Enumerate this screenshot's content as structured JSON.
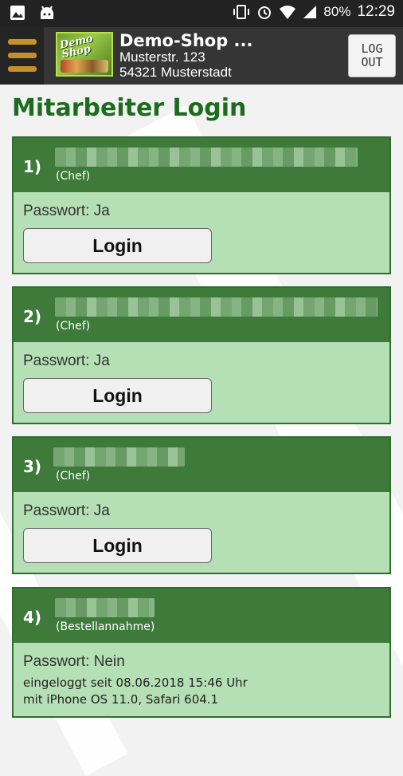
{
  "status_bar": {
    "battery": "80%",
    "time": "12:29"
  },
  "shop": {
    "name": "Demo-Shop ...",
    "street": "Musterstr. 123",
    "city": "54321 Musterstadt",
    "logo_text": "Demo Shop"
  },
  "header": {
    "logout_line1": "LOG",
    "logout_line2": "OUT"
  },
  "page": {
    "title": "Mitarbeiter Login"
  },
  "employees": [
    {
      "number": "1)",
      "role": "(Chef)",
      "password": "Passwort: Ja",
      "login_label": "Login"
    },
    {
      "number": "2)",
      "role": "(Chef)",
      "password": "Passwort: Ja",
      "login_label": "Login"
    },
    {
      "number": "3)",
      "role": "(Chef)",
      "password": "Passwort: Ja",
      "login_label": "Login"
    },
    {
      "number": "4)",
      "role": "(Bestellannahme)",
      "password": "Passwort: Nein",
      "logged_in_since": "eingeloggt seit 08.06.2018 15:46 Uhr",
      "device": "mit iPhone OS 11.0, Safari 604.1"
    }
  ],
  "colors": {
    "primary_green": "#3e7a3a",
    "card_bg": "#b5dfb4",
    "title_green": "#1d6b1d"
  }
}
